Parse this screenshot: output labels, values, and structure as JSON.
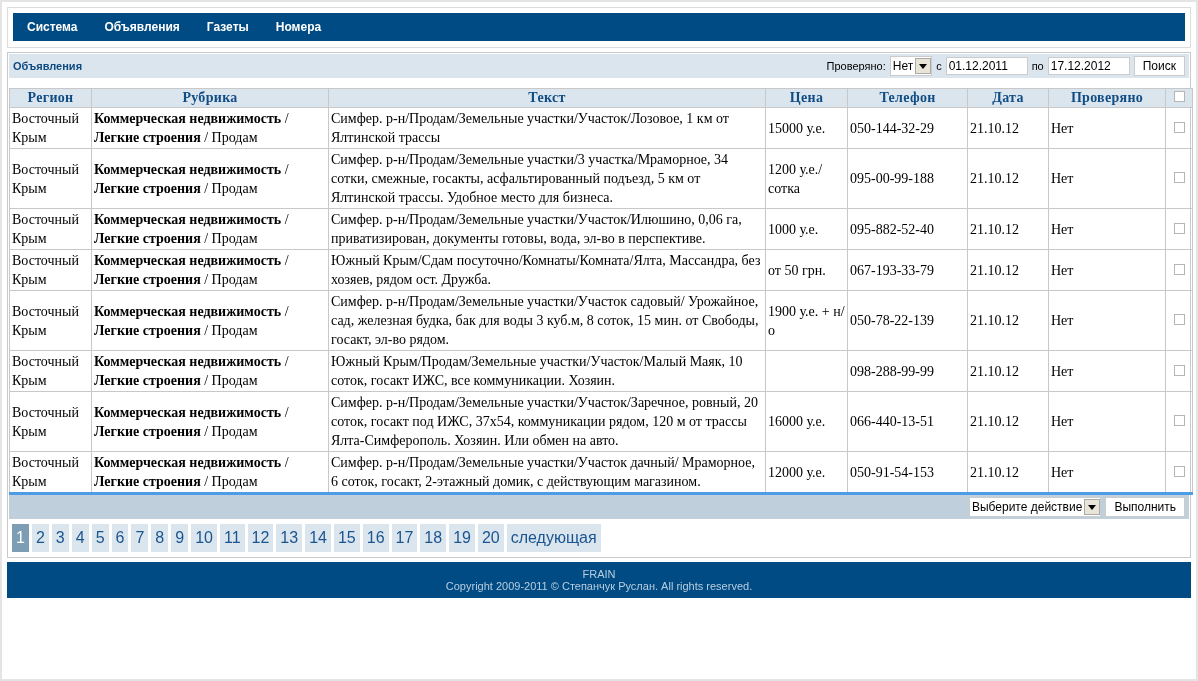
{
  "nav": {
    "items": [
      "Система",
      "Объявления",
      "Газеты",
      "Номера"
    ]
  },
  "panel": {
    "title": "Объявления"
  },
  "filter": {
    "checked_label": "Проверяно:",
    "checked_value": "Нет",
    "from_label": "с",
    "from_value": "01.12.2011",
    "to_label": "по",
    "to_value": "17.12.2012",
    "search_button": "Поиск"
  },
  "table": {
    "columns": [
      "Регион",
      "Рубрика",
      "Текст",
      "Цена",
      "Телефон",
      "Дата",
      "Проверяно"
    ],
    "select_all_checked": false,
    "rows": [
      {
        "region": "Восточный Крым",
        "rubric": "**Коммерческая недвижимость** / **Легкие строения** / Продам",
        "text": "Симфер. р-н/Продам/Земельные участки/Участок/Лозовое, 1 км от Ялтинской трассы",
        "price": "15000 у.е.",
        "phone": "050-144-32-29",
        "date": "21.10.12",
        "verified": "Нет",
        "checked": false
      },
      {
        "region": "Восточный Крым",
        "rubric": "**Коммерческая недвижимость** / **Легкие строения** / Продам",
        "text": "Симфер. р-н/Продам/Земельные участки/3 участка/Мраморное, 34 сотки, смежные, госакты, асфальтированный подъезд, 5 км от Ялтинской трассы. Удобное место для бизнеса.",
        "price": "1200 у.е./ сотка",
        "phone": "095-00-99-188",
        "date": "21.10.12",
        "verified": "Нет",
        "checked": false
      },
      {
        "region": "Восточный Крым",
        "rubric": "**Коммерческая недвижимость** / **Легкие строения** / Продам",
        "text": "Симфер. р-н/Продам/Земельные участки/Участок/Илюшино, 0,06 га, приватизирован, документы готовы, вода, эл-во в перспективе.",
        "price": "1000 у.е.",
        "phone": "095-882-52-40",
        "date": "21.10.12",
        "verified": "Нет",
        "checked": false
      },
      {
        "region": "Восточный Крым",
        "rubric": "**Коммерческая недвижимость** / **Легкие строения** / Продам",
        "text": "Южный Крым/Сдам посуточно/Комнаты/Комната/Ялта, Массандра, без хозяев, рядом ост. Дружба.",
        "price": "от 50 грн.",
        "phone": "067-193-33-79",
        "date": "21.10.12",
        "verified": "Нет",
        "checked": false
      },
      {
        "region": "Восточный Крым",
        "rubric": "**Коммерческая недвижимость** / **Легкие строения** / Продам",
        "text": "Симфер. р-н/Продам/Земельные участки/Участок садовый/ Урожайное, сад, железная будка, бак для воды 3 куб.м, 8 соток, 15 мин. от Свободы, госакт, эл-во рядом.",
        "price": "1900 у.е. + н/о",
        "phone": "050-78-22-139",
        "date": "21.10.12",
        "verified": "Нет",
        "checked": false
      },
      {
        "region": "Восточный Крым",
        "rubric": "**Коммерческая недвижимость** / **Легкие строения** / Продам",
        "text": "Южный Крым/Продам/Земельные участки/Участок/Малый Маяк, 10 соток, госакт ИЖС, все коммуникации. Хозяин.",
        "phone": "098-288-99-99",
        "date": "21.10.12",
        "verified": "Нет",
        "checked": false
      },
      {
        "region": "Восточный Крым",
        "rubric": "**Коммерческая недвижимость** / **Легкие строения** / Продам",
        "text": "Симфер. р-н/Продам/Земельные участки/Участок/Заречное, ровный, 20 соток, госакт под ИЖС, 37х54, коммуникации рядом, 120 м от трассы Ялта-Симферополь. Хозяин. Или обмен на авто.",
        "price": "16000 у.е.",
        "phone": "066-440-13-51",
        "date": "21.10.12",
        "verified": "Нет",
        "checked": false
      },
      {
        "region": "Восточный Крым",
        "rubric": "**Коммерческая недвижимость** / **Легкие строения** / Продам",
        "text": "Симфер. р-н/Продам/Земельные участки/Участок дачный/ Мраморное, 6 соток, госакт, 2-этажный домик, с действующим магазином.",
        "price": "12000 у.е.",
        "phone": "050-91-54-153",
        "date": "21.10.12",
        "verified": "Нет",
        "checked": false
      }
    ]
  },
  "actions": {
    "select_value": "Выберите действие",
    "run_button": "Выполнить"
  },
  "pagination": [
    {
      "label": "1",
      "selected": true
    },
    {
      "label": "2",
      "selected": false
    },
    {
      "label": "3",
      "selected": false
    },
    {
      "label": "4",
      "selected": false
    },
    {
      "label": "5",
      "selected": false
    },
    {
      "label": "6",
      "selected": false
    },
    {
      "label": "7",
      "selected": false
    },
    {
      "label": "8",
      "selected": false
    },
    {
      "label": "9",
      "selected": false
    },
    {
      "label": "10",
      "selected": false
    },
    {
      "label": "11",
      "selected": false
    },
    {
      "label": "12",
      "selected": false
    },
    {
      "label": "13",
      "selected": false
    },
    {
      "label": "14",
      "selected": false
    },
    {
      "label": "15",
      "selected": false
    },
    {
      "label": "16",
      "selected": false
    },
    {
      "label": "17",
      "selected": false
    },
    {
      "label": "18",
      "selected": false
    },
    {
      "label": "19",
      "selected": false
    },
    {
      "label": "20",
      "selected": false
    },
    {
      "label": "следующая",
      "selected": false
    }
  ],
  "footer": {
    "brand": "FRAIN",
    "copyright": "Copyright 2009-2011 © Степанчук Руслан. All rights reserved."
  }
}
